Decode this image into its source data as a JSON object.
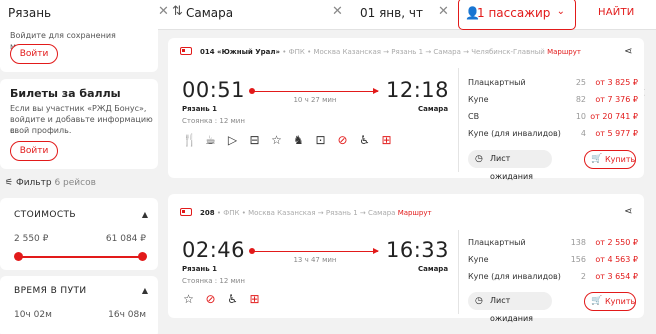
{
  "search": {
    "from": "Рязань",
    "to": "Самара",
    "date": "01 янв, чт",
    "passengers": "1 пассажир",
    "find_label": "НАЙТИ"
  },
  "sidebar": {
    "login_text": "Войдите для сохранения маршрута",
    "login_button": "Войти",
    "bonus": {
      "title": "Билеты за баллы",
      "text_line1": "Если вы участник «РЖД Бонус»,",
      "text_line2": "войдите и добавьте информацию в",
      "text_line3": "свой профиль.",
      "button": "Войти"
    },
    "filter": {
      "label": "Фильтр",
      "count": "6 рейсов"
    },
    "cost": {
      "title": "СТОИМОСТЬ",
      "min": "2 550 ₽",
      "max": "61 084 ₽"
    },
    "travel_time": {
      "title": "ВРЕМЯ В ПУТИ",
      "min": "10ч 02м",
      "max": "16ч 08м"
    }
  },
  "trains": [
    {
      "number": "014 «Южный Урал»",
      "carrier": "• ФПК •",
      "route": "Москва Казанская → Рязань 1 → Самара → Челябинск-Главный",
      "route_link": "Маршрут",
      "depart_time": "00:51",
      "arrive_time": "12:18",
      "duration": "10 ч 27 мин",
      "depart_station": "Рязань 1",
      "arrive_station": "Самара",
      "stop": "Стоянка : 12 мин",
      "amenity_icons": [
        "restaurant-icon",
        "coffee-icon",
        "tv-icon",
        "bed-icon",
        "star-icon",
        "pets-icon",
        "train-car-icon",
        "no-smoking-icon",
        "wheelchair-icon",
        "gift-icon"
      ],
      "classes": [
        {
          "name": "Плацкартный",
          "count": "25",
          "price": "от 3 825 ₽"
        },
        {
          "name": "Купе",
          "count": "82",
          "price": "от 7 376 ₽"
        },
        {
          "name": "СВ",
          "count": "10",
          "price": "от 20 741 ₽"
        },
        {
          "name": "Купе (для инвалидов)",
          "count": "4",
          "price": "от 5 977 ₽"
        }
      ],
      "wait_list": "Лист ожидания",
      "buy": "Купить"
    },
    {
      "number": "208",
      "carrier": "• ФПК •",
      "route": "Москва Казанская → Рязань 1 → Самара",
      "route_link": "Маршрут",
      "depart_time": "02:46",
      "arrive_time": "16:33",
      "duration": "13 ч 47 мин",
      "depart_station": "Рязань 1",
      "arrive_station": "Самара",
      "stop": "Стоянка : 12 мин",
      "amenity_icons": [
        "star-icon",
        "no-smoking-icon",
        "wheelchair-icon",
        "gift-icon"
      ],
      "classes": [
        {
          "name": "Плацкартный",
          "count": "138",
          "price": "от 2 550 ₽"
        },
        {
          "name": "Купе",
          "count": "156",
          "price": "от 4 563 ₽"
        },
        {
          "name": "Купе (для инвалидов)",
          "count": "2",
          "price": "от 3 654 ₽"
        }
      ],
      "wait_list": "Лист ожидания",
      "buy": "Купить"
    }
  ]
}
